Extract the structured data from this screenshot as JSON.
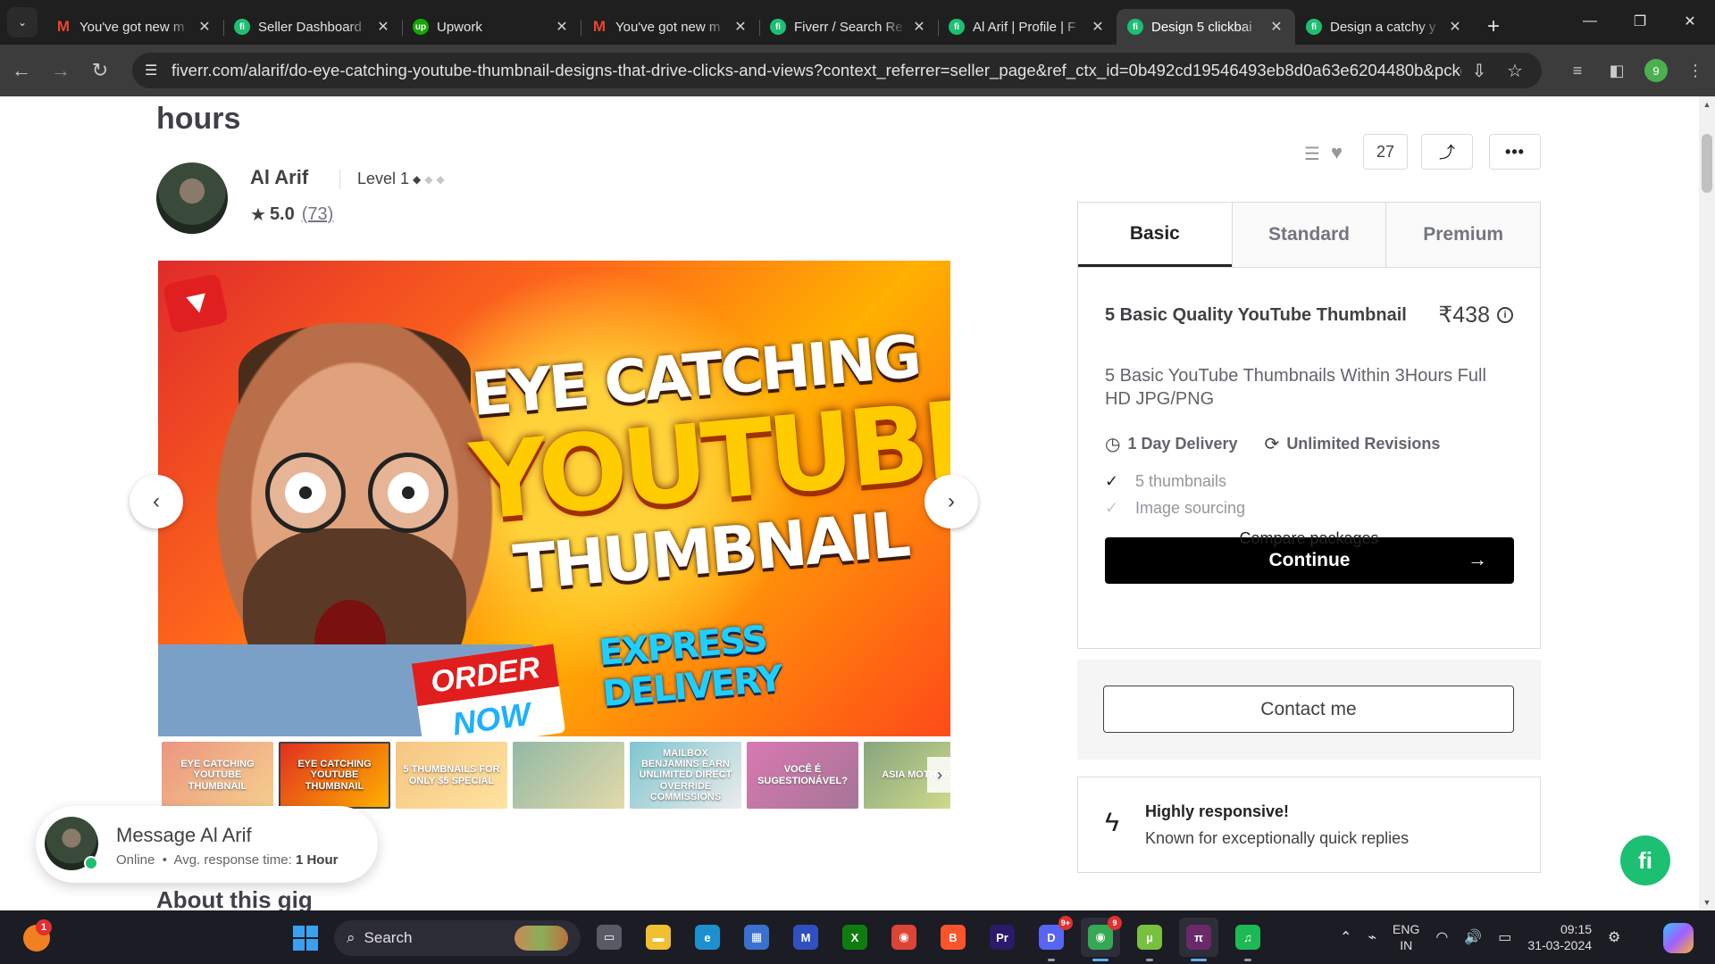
{
  "browser": {
    "tabs": [
      {
        "title": "You've got new m",
        "favicon": "gmail-icon",
        "active": false
      },
      {
        "title": "Seller Dashboard",
        "favicon": "fiverr-icon",
        "active": false
      },
      {
        "title": "Upwork",
        "favicon": "upwork-icon",
        "active": false
      },
      {
        "title": "You've got new m",
        "favicon": "gmail-icon",
        "active": false
      },
      {
        "title": "Fiverr / Search Re",
        "favicon": "fiverr-icon",
        "active": false
      },
      {
        "title": "Al Arif | Profile | F",
        "favicon": "fiverr-icon",
        "active": false
      },
      {
        "title": "Design 5 clickbai",
        "favicon": "fiverr-icon",
        "active": true
      },
      {
        "title": "Design a catchy y",
        "favicon": "fiverr-icon",
        "active": false
      }
    ],
    "favicon_glyphs": {
      "gmail": "M",
      "fiverr": "fi",
      "upwork": "up"
    },
    "close_glyph": "✕",
    "new_tab_glyph": "+",
    "tab_menu_glyph": "⌄",
    "window_controls": {
      "minimize": "—",
      "restore": "❐",
      "close": "✕"
    },
    "nav": {
      "back": "←",
      "forward": "→",
      "reload": "↻"
    },
    "url": "fiverr.com/alarif/do-eye-catching-youtube-thumbnail-designs-that-drive-clicks-and-views?context_referrer=seller_page&ref_ctx_id=0b492cd19546493eb8d0a63e6204480b&pckg_id=1...",
    "site_info_glyph": "☰",
    "install_glyph": "⇩",
    "bookmark_glyph": "☆",
    "profile_letter": "9",
    "toolbar_icons": {
      "media": "≡",
      "side_panel": "◧",
      "menu": "⋮"
    }
  },
  "gig": {
    "title_fragment": "hours",
    "seller": {
      "name": "Al Arif",
      "level": "Level 1",
      "rating": "5.0",
      "review_count": "(73)",
      "star_glyph": "★",
      "diamond_glyph": "◆"
    },
    "actions": {
      "collections_glyph": "☰",
      "heart_glyph": "♥",
      "likes": "27",
      "share_glyph": "⤴",
      "more_glyph": "•••"
    },
    "thumbnail": {
      "line1": "EYE CATCHING",
      "line2": "YOUTUBE",
      "line3": "THUMBNAIL",
      "express": "EXPRESS DELIVERY",
      "order_line1": "ORDER",
      "order_line2": "NOW"
    },
    "carousel": {
      "prev_glyph": "‹",
      "next_glyph": "›"
    },
    "thumbs": [
      {
        "text": "EYE CATCHING YOUTUBE THUMBNAIL",
        "colors": [
          "#e05030",
          "#f0b040"
        ]
      },
      {
        "text": "EYE CATCHING YOUTUBE THUMBNAIL",
        "colors": [
          "#e03020",
          "#ffb000"
        ]
      },
      {
        "text": "5 THUMBNAILS FOR ONLY $5 SPECIAL",
        "colors": [
          "#f0a030",
          "#ffd060"
        ]
      },
      {
        "text": "",
        "colors": [
          "#4a8a6a",
          "#d0c070"
        ]
      },
      {
        "text": "MAILBOX BENJAMINS EARN UNLIMITED DIRECT OVERRIDE COMMISSIONS",
        "colors": [
          "#2aa0b0",
          "#e0e0e0"
        ]
      },
      {
        "text": "VOCÊ É SUGESTIONÁVEL?",
        "colors": [
          "#c02080",
          "#6a1a50"
        ]
      },
      {
        "text": "ASIA MOTHERB",
        "colors": [
          "#3a6a2a",
          "#c0d040"
        ]
      }
    ],
    "about_title": "About this gig"
  },
  "message_card": {
    "title": "Message Al Arif",
    "status": "Online",
    "separator": "•",
    "response_label": "Avg. response time:",
    "response_value": "1 Hour"
  },
  "packages": {
    "tabs": [
      "Basic",
      "Standard",
      "Premium"
    ],
    "active_tab": "Basic",
    "name": "5 Basic Quality YouTube Thumbnail",
    "price": "₹438",
    "info_glyph": "i",
    "description": "5 Basic YouTube Thumbnails Within 3Hours Full HD JPG/PNG",
    "delivery": "1 Day Delivery",
    "delivery_glyph": "◷",
    "revisions": "Unlimited Revisions",
    "revisions_glyph": "⟳",
    "features": [
      {
        "label": "5 thumbnails",
        "included": true
      },
      {
        "label": "Image sourcing",
        "included": false
      }
    ],
    "check_glyph": "✓",
    "continue_label": "Continue",
    "continue_arrow": "→",
    "compare_label": "Compare packages"
  },
  "contact_label": "Contact me",
  "responsive": {
    "title": "Highly responsive!",
    "subtitle": "Known for exceptionally quick replies",
    "bolt_glyph": "ϟ"
  },
  "fab_label": "fi",
  "taskbar": {
    "widget_badge": "1",
    "search_label": "Search",
    "search_glyph": "⌕",
    "apps": [
      {
        "name": "task-view",
        "label": "▭",
        "bg": "#5a5a66",
        "active": false
      },
      {
        "name": "file-explorer",
        "label": "▬",
        "bg": "#f0c030",
        "active": false
      },
      {
        "name": "edge",
        "label": "e",
        "bg": "#1e90d0",
        "active": false
      },
      {
        "name": "microsoft-store",
        "label": "▦",
        "bg": "#3a70d0",
        "active": false
      },
      {
        "name": "app-blue",
        "label": "M",
        "bg": "#3050c0",
        "active": false
      },
      {
        "name": "xbox",
        "label": "X",
        "bg": "#107c10",
        "active": false
      },
      {
        "name": "chrome",
        "label": "◉",
        "bg": "#db4437",
        "active": false
      },
      {
        "name": "brave",
        "label": "B",
        "bg": "#fb542b",
        "active": false
      },
      {
        "name": "premiere-pro",
        "label": "Pr",
        "bg": "#2a1a6a",
        "active": false
      },
      {
        "name": "discord",
        "label": "D",
        "bg": "#5865f2",
        "active": false,
        "badge": "9+"
      },
      {
        "name": "chrome-profile",
        "label": "◉",
        "bg": "#34a853",
        "active": true,
        "badge": "9"
      },
      {
        "name": "utorrent",
        "label": "µ",
        "bg": "#78c040",
        "active": false
      },
      {
        "name": "pi-network",
        "label": "π",
        "bg": "#6a2a6a",
        "active": true
      },
      {
        "name": "spotify",
        "label": "♫",
        "bg": "#1db954",
        "active": false
      }
    ],
    "tray": {
      "chevron": "⌃",
      "network_off": "⌁",
      "lang_1": "ENG",
      "lang_2": "IN",
      "wifi": "◠",
      "volume": "🔊",
      "battery": "▭",
      "time": "09:15",
      "date": "31-03-2024",
      "settings": "⚙"
    }
  }
}
